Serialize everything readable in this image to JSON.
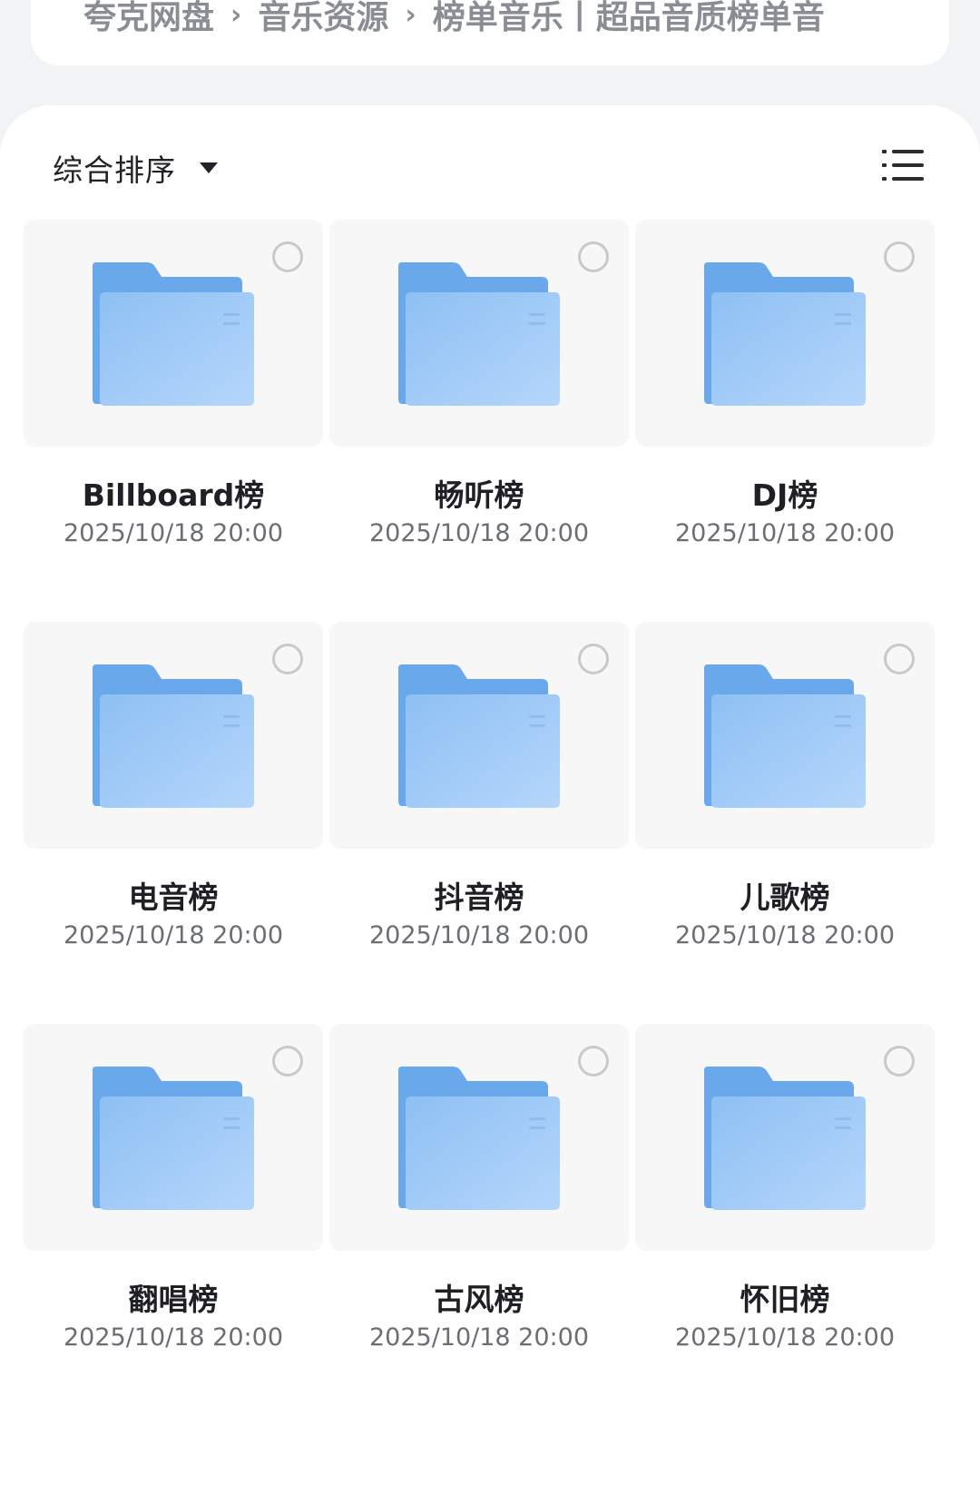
{
  "breadcrumb": {
    "items": [
      "夸克网盘",
      "音乐资源",
      "榜单音乐丨超品音质榜单音"
    ]
  },
  "toolbar": {
    "sort_label": "综合排序",
    "view_toggle_icon": "list-view-icon"
  },
  "colors": {
    "folder_back": "#6aa8ec",
    "folder_front_start": "#8ec0f3",
    "folder_front_end": "#b5d6fb",
    "accent_text": "#1f2024"
  },
  "folders": [
    {
      "name": "Billboard榜",
      "date": "2025/10/18 20:00",
      "icon": "folder-icon"
    },
    {
      "name": "畅听榜",
      "date": "2025/10/18 20:00",
      "icon": "folder-icon"
    },
    {
      "name": "DJ榜",
      "date": "2025/10/18 20:00",
      "icon": "folder-icon"
    },
    {
      "name": "电音榜",
      "date": "2025/10/18 20:00",
      "icon": "folder-icon"
    },
    {
      "name": "抖音榜",
      "date": "2025/10/18 20:00",
      "icon": "folder-icon"
    },
    {
      "name": "儿歌榜",
      "date": "2025/10/18 20:00",
      "icon": "folder-icon"
    },
    {
      "name": "翻唱榜",
      "date": "2025/10/18 20:00",
      "icon": "folder-icon"
    },
    {
      "name": "古风榜",
      "date": "2025/10/18 20:00",
      "icon": "folder-icon"
    },
    {
      "name": "怀旧榜",
      "date": "2025/10/18 20:00",
      "icon": "folder-icon"
    }
  ]
}
